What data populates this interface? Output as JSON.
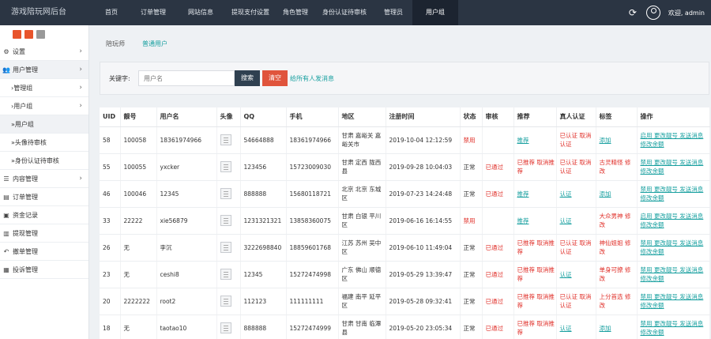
{
  "brand": "游戏陪玩网后台",
  "nav": [
    {
      "label": "首页",
      "width": 46
    },
    {
      "label": "订单管理",
      "width": 60
    },
    {
      "label": "网站信息",
      "width": 60
    },
    {
      "label": "提现支付设置",
      "width": 66
    },
    {
      "label": "角色管理",
      "width": 48
    },
    {
      "label": "身份认证待审核",
      "width": 76
    },
    {
      "label": "管理员",
      "width": 48
    },
    {
      "label": "用户组",
      "width": 58
    }
  ],
  "user": {
    "name": "欢迎, admin"
  },
  "sidebar": {
    "items": [
      {
        "label": "设置",
        "icon": "gear-icon",
        "glyph": "⚙",
        "chev": "›",
        "sub": false,
        "active": false
      },
      {
        "label": "用户管理",
        "icon": "users-icon",
        "glyph": "👥",
        "chev": "›",
        "sub": false,
        "active": true
      },
      {
        "label": "›管理组",
        "icon": "",
        "glyph": "",
        "chev": "›",
        "sub": true,
        "active": false
      },
      {
        "label": "›用户组",
        "icon": "",
        "glyph": "",
        "chev": "›",
        "sub": true,
        "active": false
      },
      {
        "label": "»用户组",
        "icon": "",
        "glyph": "",
        "chev": "",
        "sub": true,
        "active": true
      },
      {
        "label": "»头像待审核",
        "icon": "",
        "glyph": "",
        "chev": "",
        "sub": true,
        "active": false
      },
      {
        "label": "»身份认证待审核",
        "icon": "",
        "glyph": "",
        "chev": "",
        "sub": true,
        "active": false
      },
      {
        "label": "内容管理",
        "icon": "list-icon",
        "glyph": "☰",
        "chev": "›",
        "sub": false,
        "active": false
      },
      {
        "label": "订单管理",
        "icon": "order-icon",
        "glyph": "▤",
        "chev": "",
        "sub": false,
        "active": false
      },
      {
        "label": "资金记录",
        "icon": "money-icon",
        "glyph": "▣",
        "chev": "",
        "sub": false,
        "active": false
      },
      {
        "label": "提现管理",
        "icon": "withdraw-icon",
        "glyph": "▥",
        "chev": "",
        "sub": false,
        "active": false
      },
      {
        "label": "撤单管理",
        "icon": "undo-icon",
        "glyph": "↶",
        "chev": "",
        "sub": false,
        "active": false
      },
      {
        "label": "投诉管理",
        "icon": "complaint-icon",
        "glyph": "▦",
        "chev": "",
        "sub": false,
        "active": false
      }
    ]
  },
  "tabs": [
    "陪玩师",
    "普通用户"
  ],
  "search": {
    "label": "关键字:",
    "placeholder": "用户名",
    "button": "搜索",
    "clear": "清空",
    "send_all": "给所有人发消息"
  },
  "table": {
    "columns": [
      "UID",
      "靓号",
      "用户名",
      "头像",
      "QQ",
      "手机",
      "地区",
      "注册时间",
      "状态",
      "审核",
      "推荐",
      "真人认证",
      "标签",
      "操作"
    ],
    "rows": [
      {
        "uid": "58",
        "num": "100058",
        "name": "18361974966",
        "qq": "54664888",
        "phone": "18361974966",
        "region": "甘肃 嘉峪关 嘉峪关市",
        "time": "2019-10-04 12:12:59",
        "status": "禁用",
        "status_red": true,
        "audit": "",
        "rec": "推荐",
        "rec_red": false,
        "real": "已认证 取消认证",
        "real_red": true,
        "tag": "添加",
        "tag_red": false,
        "ops": "启用 更改靓号 发送消息 修改余额"
      },
      {
        "uid": "55",
        "num": "100055",
        "name": "yxcker",
        "qq": "123456",
        "phone": "15723009030",
        "region": "甘肃 定西 陇西县",
        "time": "2019-09-28 10:04:03",
        "status": "正常",
        "status_red": false,
        "audit": "已通过",
        "rec": "已推荐 取消推荐",
        "rec_red": true,
        "real": "已认证 取消认证",
        "real_red": true,
        "tag": "古灵精怪 修改",
        "tag_red": true,
        "ops": "禁用 更改靓号 发送消息 修改余额"
      },
      {
        "uid": "46",
        "num": "100046",
        "name": "12345",
        "qq": "888888",
        "phone": "15680118721",
        "region": "北京 北京 东城区",
        "time": "2019-07-23 14:24:48",
        "status": "正常",
        "status_red": false,
        "audit": "已通过",
        "rec": "推荐",
        "rec_red": false,
        "real": "认证",
        "real_red": false,
        "tag": "添加",
        "tag_red": false,
        "ops": "禁用 更改靓号 发送消息 修改余额"
      },
      {
        "uid": "33",
        "num": "22222",
        "name": "xie56879",
        "qq": "1231321321",
        "phone": "13858360075",
        "region": "甘肃 白银 平川区",
        "time": "2019-06-16 16:14:55",
        "status": "禁用",
        "status_red": true,
        "audit": "",
        "rec": "推荐",
        "rec_red": false,
        "real": "认证",
        "real_red": false,
        "tag": "大众男神 修改",
        "tag_red": true,
        "ops": "启用 更改靓号 发送消息 修改余额"
      },
      {
        "uid": "26",
        "num": "无",
        "name": "李沉",
        "qq": "3222698840",
        "phone": "18859601768",
        "region": "江苏 苏州 吴中区",
        "time": "2019-06-10 11:49:04",
        "status": "正常",
        "status_red": false,
        "audit": "已通过",
        "rec": "已推荐 取消推荐",
        "rec_red": true,
        "real": "已认证 取消认证",
        "real_red": true,
        "tag": "神仙姐姐 修改",
        "tag_red": true,
        "ops": "禁用 更改靓号 发送消息 修改余额"
      },
      {
        "uid": "23",
        "num": "无",
        "name": "ceshi8",
        "qq": "12345",
        "phone": "15272474998",
        "region": "广东 佛山 顺德区",
        "time": "2019-05-29 13:39:47",
        "status": "正常",
        "status_red": false,
        "audit": "已通过",
        "rec": "已推荐 取消推荐",
        "rec_red": true,
        "real": "认证",
        "real_red": false,
        "tag": "单身可撩 修改",
        "tag_red": true,
        "ops": "禁用 更改靓号 发送消息 修改余额"
      },
      {
        "uid": "20",
        "num": "2222222",
        "name": "root2",
        "qq": "112123",
        "phone": "111111111",
        "region": "福建 南平 延平区",
        "time": "2019-05-28 09:32:41",
        "status": "正常",
        "status_red": false,
        "audit": "已通过",
        "rec": "已推荐 取消推荐",
        "rec_red": true,
        "real": "已认证 取消认证",
        "real_red": true,
        "tag": "上分首选 修改",
        "tag_red": true,
        "ops": "禁用 更改靓号 发送消息 修改余额"
      },
      {
        "uid": "18",
        "num": "无",
        "name": "taotao10",
        "qq": "888888",
        "phone": "15272474999",
        "region": "甘肃 甘南 临潭县",
        "time": "2019-05-20 23:05:34",
        "status": "正常",
        "status_red": false,
        "audit": "已通过",
        "rec": "已推荐 取消推荐",
        "rec_red": true,
        "real": "认证",
        "real_red": false,
        "tag": "添加",
        "tag_red": false,
        "ops": "禁用 更改靓号 发送消息 修改余额"
      }
    ]
  },
  "colors": {
    "topbar": "#2b3543",
    "accent": "#19a0a0",
    "danger": "#e0302a",
    "dark_button": "#2f4050"
  }
}
